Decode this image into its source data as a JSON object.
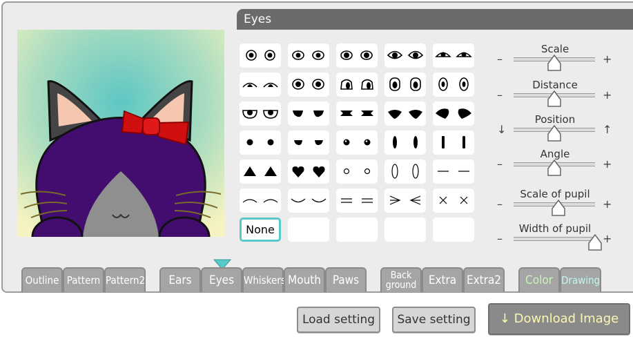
{
  "panel": {
    "title": "Eyes"
  },
  "grid": {
    "none_label": "None"
  },
  "sliders": [
    {
      "label": "Scale",
      "left": "–",
      "right": "+",
      "value": 0.5
    },
    {
      "label": "Distance",
      "left": "–",
      "right": "+",
      "value": 0.5
    },
    {
      "label": "Position",
      "left": "↓",
      "right": "↑",
      "value": 0.5
    },
    {
      "label": "Angle",
      "left": "–",
      "right": "+",
      "value": 0.5
    },
    {
      "label": "Scale of pupil",
      "left": "–",
      "right": "+",
      "value": 0.55
    },
    {
      "label": "Width of pupil",
      "left": "–",
      "right": "+",
      "value": 1.0
    }
  ],
  "tabs": {
    "outline": "Outline",
    "pattern": "Pattern",
    "pattern2": "Pattern2",
    "ears": "Ears",
    "eyes": "Eyes",
    "whiskers": "Whiskers",
    "mouth": "Mouth",
    "paws": "Paws",
    "background_1": "Back",
    "background_2": "ground",
    "extra": "Extra",
    "extra2": "Extra2",
    "color": "Color",
    "drawing": "Drawing"
  },
  "active_tab": "Eyes",
  "buttons": {
    "load": "Load setting",
    "save": "Save setting",
    "download": "Download Image",
    "download_icon": "↓"
  },
  "colors": {
    "accent": "#59c8c9",
    "tab_bg": "#a5a5a5",
    "color_tab_text": "#c8f5b8",
    "drawing_tab_text": "#bff7f0",
    "download_text": "#fbf7b0"
  }
}
